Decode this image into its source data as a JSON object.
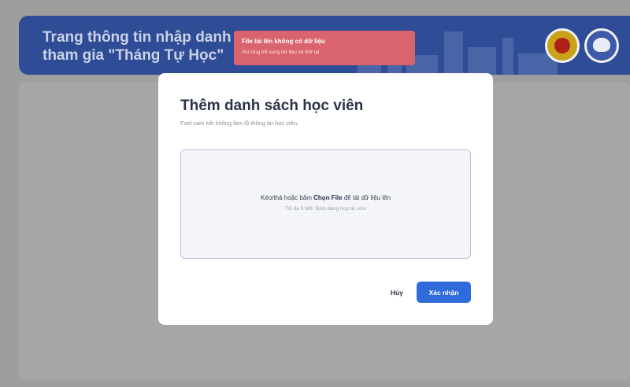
{
  "header": {
    "title_line1": "Trang thông tin nhập danh s",
    "title_line2": "tham gia \"Tháng Tự Học\""
  },
  "toast": {
    "title": "File tải lên không có dữ liệu",
    "message": "Vui lòng bổ sung dữ liệu và thử lại"
  },
  "modal": {
    "title": "Thêm danh sách học viên",
    "subtitle": "Fsel cam kết không làm lộ thông tin học viên.",
    "dropzone": {
      "text_before": "Kéo/thả hoặc bấm ",
      "link": "Chọn File",
      "text_after": " để tải dữ liệu lên",
      "hint": "Tối đa 5 MB. Định dạng hợp lệ .xlsx"
    },
    "cancel_label": "Hủy",
    "confirm_label": "Xác nhận"
  },
  "colors": {
    "header_bg": "#2f4c96",
    "overlay": "#9e9e9e",
    "toast_bg": "#d9646d",
    "primary": "#2f6bdb"
  }
}
